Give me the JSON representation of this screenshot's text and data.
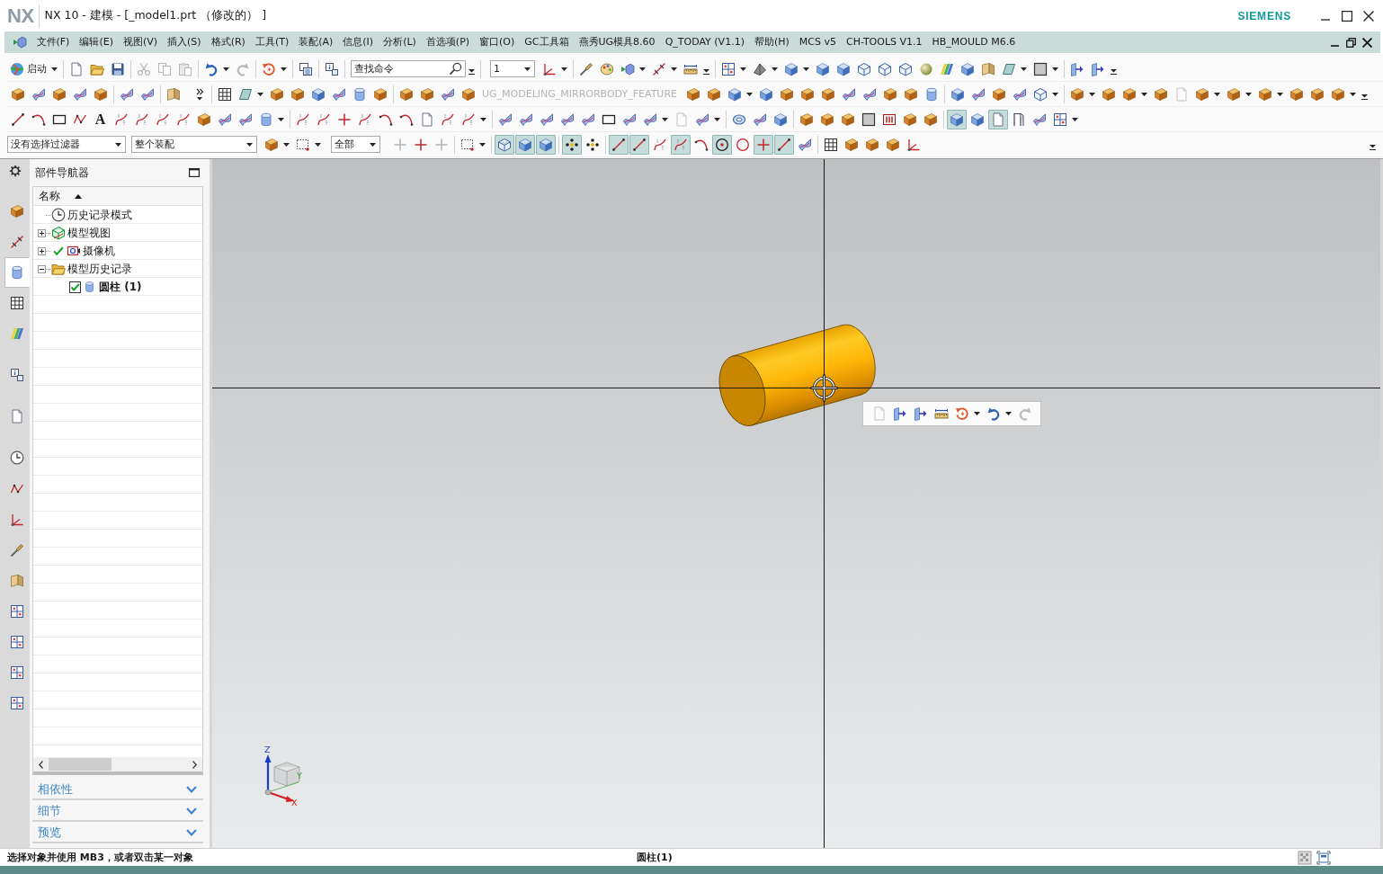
{
  "window": {
    "logo": "NX",
    "title": "NX 10 - 建模 - [_model1.prt （修改的） ]",
    "brand": "SIEMENS"
  },
  "menu_bar": {
    "items": [
      {
        "label": "文件(F)"
      },
      {
        "label": "编辑(E)"
      },
      {
        "label": "视图(V)"
      },
      {
        "label": "插入(S)"
      },
      {
        "label": "格式(R)"
      },
      {
        "label": "工具(T)"
      },
      {
        "label": "装配(A)"
      },
      {
        "label": "信息(I)"
      },
      {
        "label": "分析(L)"
      },
      {
        "label": "首选项(P)"
      },
      {
        "label": "窗口(O)"
      },
      {
        "label": "GC工具箱"
      },
      {
        "label": "燕秀UG模具8.60"
      },
      {
        "label": "Q_TODAY (V1.1)"
      },
      {
        "label": "帮助(H)"
      },
      {
        "label": "MCS v5"
      },
      {
        "label": "CH-TOOLS V1.1"
      },
      {
        "label": "HB_MOULD M6.6"
      }
    ]
  },
  "toolbars": [
    {
      "items": [
        {
          "kind": "start",
          "label": "启动"
        },
        {
          "kind": "separator"
        },
        {
          "kind": "tool",
          "pressed": false,
          "disabled": false
        },
        {
          "kind": "tool",
          "pressed": false,
          "disabled": false
        },
        {
          "kind": "tool",
          "pressed": false,
          "disabled": false
        },
        {
          "kind": "separator"
        },
        {
          "kind": "tool",
          "pressed": false,
          "disabled": true
        },
        {
          "kind": "tool",
          "pressed": false,
          "disabled": true
        },
        {
          "kind": "tool",
          "pressed": false,
          "disabled": true
        },
        {
          "kind": "separator"
        },
        {
          "kind": "split",
          "pressed": false,
          "disabled": false
        },
        {
          "kind": "tool",
          "pressed": false,
          "disabled": true
        },
        {
          "kind": "separator"
        },
        {
          "kind": "split",
          "pressed": false,
          "disabled": false
        },
        {
          "kind": "separator"
        },
        {
          "kind": "tool",
          "pressed": false,
          "disabled": false
        },
        {
          "kind": "separator"
        },
        {
          "kind": "tool",
          "pressed": false,
          "disabled": false
        },
        {
          "kind": "separator"
        },
        {
          "kind": "search",
          "placeholder": "查找命令"
        },
        {
          "kind": "overflow"
        },
        {
          "kind": "separator"
        },
        {
          "kind": "select",
          "value": "1"
        },
        {
          "kind": "split",
          "pressed": false,
          "disabled": false
        },
        {
          "kind": "separator"
        },
        {
          "kind": "tool",
          "pressed": false,
          "disabled": false
        },
        {
          "kind": "tool",
          "pressed": false,
          "disabled": false
        },
        {
          "kind": "split",
          "pressed": false,
          "disabled": false
        },
        {
          "kind": "split",
          "pressed": false,
          "disabled": false
        },
        {
          "kind": "tool",
          "pressed": false,
          "disabled": false
        },
        {
          "kind": "overflow"
        },
        {
          "kind": "separator"
        },
        {
          "kind": "split",
          "pressed": false,
          "disabled": false
        },
        {
          "kind": "split",
          "pressed": false,
          "disabled": false
        },
        {
          "kind": "split",
          "pressed": false,
          "disabled": false
        },
        {
          "kind": "tool",
          "pressed": false,
          "disabled": false
        },
        {
          "kind": "tool",
          "pressed": false,
          "disabled": false
        },
        {
          "kind": "tool",
          "pressed": false,
          "disabled": false
        },
        {
          "kind": "tool",
          "pressed": false,
          "disabled": false
        },
        {
          "kind": "tool",
          "pressed": false,
          "disabled": false
        },
        {
          "kind": "tool",
          "pressed": false,
          "disabled": false
        },
        {
          "kind": "tool",
          "pressed": false,
          "disabled": false
        },
        {
          "kind": "tool",
          "pressed": false,
          "disabled": false
        },
        {
          "kind": "tool",
          "pressed": false,
          "disabled": false
        },
        {
          "kind": "split",
          "pressed": false,
          "disabled": false
        },
        {
          "kind": "split",
          "pressed": false,
          "disabled": false
        },
        {
          "kind": "separator"
        },
        {
          "kind": "tool",
          "pressed": false,
          "disabled": false
        },
        {
          "kind": "tool",
          "pressed": false,
          "disabled": false
        },
        {
          "kind": "overflow"
        }
      ]
    },
    {
      "items": [
        {
          "kind": "tool",
          "pressed": false,
          "disabled": false
        },
        {
          "kind": "tool",
          "pressed": false,
          "disabled": false
        },
        {
          "kind": "tool",
          "pressed": false,
          "disabled": false
        },
        {
          "kind": "tool",
          "pressed": false,
          "disabled": false
        },
        {
          "kind": "tool",
          "pressed": false,
          "disabled": false
        },
        {
          "kind": "separator"
        },
        {
          "kind": "tool",
          "pressed": false,
          "disabled": false
        },
        {
          "kind": "tool",
          "pressed": false,
          "disabled": false
        },
        {
          "kind": "separator"
        },
        {
          "kind": "tool",
          "pressed": false,
          "disabled": false
        },
        {
          "kind": "more"
        },
        {
          "kind": "separator"
        },
        {
          "kind": "tool",
          "pressed": false,
          "disabled": false
        },
        {
          "kind": "split",
          "pressed": false,
          "disabled": false
        },
        {
          "kind": "tool",
          "pressed": false,
          "disabled": false
        },
        {
          "kind": "tool",
          "pressed": false,
          "disabled": false
        },
        {
          "kind": "tool",
          "pressed": false,
          "disabled": false
        },
        {
          "kind": "tool",
          "pressed": false,
          "disabled": false
        },
        {
          "kind": "tool",
          "pressed": false,
          "disabled": false
        },
        {
          "kind": "tool",
          "pressed": false,
          "disabled": false
        },
        {
          "kind": "separator"
        },
        {
          "kind": "tool",
          "pressed": false,
          "disabled": false
        },
        {
          "kind": "tool",
          "pressed": false,
          "disabled": false
        },
        {
          "kind": "tool",
          "pressed": false,
          "disabled": false
        },
        {
          "kind": "tool",
          "pressed": false,
          "disabled": false
        },
        {
          "kind": "label",
          "label": "UG_MODELING_MIRRORBODY_FEATURE",
          "disabled": true
        },
        {
          "kind": "tool",
          "pressed": false,
          "disabled": false
        },
        {
          "kind": "tool",
          "pressed": false,
          "disabled": false
        },
        {
          "kind": "split",
          "pressed": false,
          "disabled": false
        },
        {
          "kind": "tool",
          "pressed": false,
          "disabled": false
        },
        {
          "kind": "tool",
          "pressed": false,
          "disabled": false
        },
        {
          "kind": "tool",
          "pressed": false,
          "disabled": false
        },
        {
          "kind": "tool",
          "pressed": false,
          "disabled": false
        },
        {
          "kind": "tool",
          "pressed": false,
          "disabled": false
        },
        {
          "kind": "tool",
          "pressed": false,
          "disabled": false
        },
        {
          "kind": "tool",
          "pressed": false,
          "disabled": false
        },
        {
          "kind": "tool",
          "pressed": false,
          "disabled": false
        },
        {
          "kind": "tool",
          "pressed": false,
          "disabled": false
        },
        {
          "kind": "separator"
        },
        {
          "kind": "tool",
          "pressed": false,
          "disabled": false
        },
        {
          "kind": "tool",
          "pressed": false,
          "disabled": false
        },
        {
          "kind": "tool",
          "pressed": false,
          "disabled": false
        },
        {
          "kind": "tool",
          "pressed": false,
          "disabled": false
        },
        {
          "kind": "split",
          "pressed": false,
          "disabled": false
        },
        {
          "kind": "separator"
        },
        {
          "kind": "split",
          "pressed": false,
          "disabled": false
        },
        {
          "kind": "tool",
          "pressed": false,
          "disabled": false
        },
        {
          "kind": "split",
          "pressed": false,
          "disabled": false
        },
        {
          "kind": "tool",
          "pressed": false,
          "disabled": false
        },
        {
          "kind": "tool",
          "pressed": false,
          "disabled": true
        },
        {
          "kind": "split",
          "pressed": false,
          "disabled": false
        },
        {
          "kind": "split",
          "pressed": false,
          "disabled": false
        },
        {
          "kind": "split",
          "pressed": false,
          "disabled": false
        },
        {
          "kind": "tool",
          "pressed": false,
          "disabled": false
        },
        {
          "kind": "tool",
          "pressed": false,
          "disabled": false
        },
        {
          "kind": "split",
          "pressed": false,
          "disabled": false
        },
        {
          "kind": "overflow"
        }
      ]
    },
    {
      "items": [
        {
          "kind": "tool",
          "pressed": false,
          "disabled": false
        },
        {
          "kind": "tool",
          "pressed": false,
          "disabled": false
        },
        {
          "kind": "tool",
          "pressed": false,
          "disabled": false
        },
        {
          "kind": "tool",
          "pressed": false,
          "disabled": false
        },
        {
          "kind": "glyph",
          "label": "A"
        },
        {
          "kind": "tool",
          "pressed": false,
          "disabled": false
        },
        {
          "kind": "tool",
          "pressed": false,
          "disabled": false
        },
        {
          "kind": "tool",
          "pressed": false,
          "disabled": false
        },
        {
          "kind": "tool",
          "pressed": false,
          "disabled": false
        },
        {
          "kind": "tool",
          "pressed": false,
          "disabled": false
        },
        {
          "kind": "tool",
          "pressed": false,
          "disabled": false
        },
        {
          "kind": "tool",
          "pressed": false,
          "disabled": false
        },
        {
          "kind": "split",
          "pressed": false,
          "disabled": false
        },
        {
          "kind": "separator"
        },
        {
          "kind": "tool",
          "pressed": false,
          "disabled": false
        },
        {
          "kind": "tool",
          "pressed": false,
          "disabled": false
        },
        {
          "kind": "tool",
          "pressed": false,
          "disabled": false
        },
        {
          "kind": "tool",
          "pressed": false,
          "disabled": false
        },
        {
          "kind": "tool",
          "pressed": false,
          "disabled": false
        },
        {
          "kind": "tool",
          "pressed": false,
          "disabled": false
        },
        {
          "kind": "tool",
          "pressed": false,
          "disabled": false
        },
        {
          "kind": "tool",
          "pressed": false,
          "disabled": false
        },
        {
          "kind": "split",
          "pressed": false,
          "disabled": false
        },
        {
          "kind": "separator"
        },
        {
          "kind": "tool",
          "pressed": false,
          "disabled": false
        },
        {
          "kind": "tool",
          "pressed": false,
          "disabled": false
        },
        {
          "kind": "tool",
          "pressed": false,
          "disabled": false
        },
        {
          "kind": "tool",
          "pressed": false,
          "disabled": false
        },
        {
          "kind": "tool",
          "pressed": false,
          "disabled": false
        },
        {
          "kind": "tool",
          "pressed": false,
          "disabled": false
        },
        {
          "kind": "tool",
          "pressed": false,
          "disabled": false
        },
        {
          "kind": "split",
          "pressed": false,
          "disabled": false
        },
        {
          "kind": "tool",
          "pressed": false,
          "disabled": true
        },
        {
          "kind": "split",
          "pressed": false,
          "disabled": false
        },
        {
          "kind": "separator"
        },
        {
          "kind": "tool",
          "pressed": false,
          "disabled": false
        },
        {
          "kind": "tool",
          "pressed": false,
          "disabled": false
        },
        {
          "kind": "tool",
          "pressed": false,
          "disabled": false
        },
        {
          "kind": "separator"
        },
        {
          "kind": "tool",
          "pressed": false,
          "disabled": false
        },
        {
          "kind": "tool",
          "pressed": false,
          "disabled": false
        },
        {
          "kind": "tool",
          "pressed": false,
          "disabled": false
        },
        {
          "kind": "tool",
          "pressed": false,
          "disabled": false
        },
        {
          "kind": "tool",
          "pressed": false,
          "disabled": false
        },
        {
          "kind": "tool",
          "pressed": false,
          "disabled": false
        },
        {
          "kind": "tool",
          "pressed": false,
          "disabled": false
        },
        {
          "kind": "separator"
        },
        {
          "kind": "tool",
          "pressed": true,
          "disabled": false
        },
        {
          "kind": "tool",
          "pressed": false,
          "disabled": false
        },
        {
          "kind": "tool",
          "pressed": true,
          "disabled": false
        },
        {
          "kind": "tool",
          "pressed": false,
          "disabled": false
        },
        {
          "kind": "tool",
          "pressed": false,
          "disabled": false
        },
        {
          "kind": "split",
          "pressed": false,
          "disabled": false
        }
      ]
    },
    {
      "items": [
        {
          "kind": "select",
          "value": "没有选择过滤器"
        },
        {
          "kind": "select",
          "value": "整个装配"
        },
        {
          "kind": "split",
          "pressed": false,
          "disabled": false
        },
        {
          "kind": "split",
          "pressed": false,
          "disabled": false
        },
        {
          "kind": "select",
          "value": "全部"
        },
        {
          "kind": "tool",
          "pressed": false,
          "disabled": true
        },
        {
          "kind": "tool",
          "pressed": false,
          "disabled": false
        },
        {
          "kind": "tool",
          "pressed": false,
          "disabled": true
        },
        {
          "kind": "separator"
        },
        {
          "kind": "split",
          "pressed": false,
          "disabled": false
        },
        {
          "kind": "separator"
        },
        {
          "kind": "tool",
          "pressed": true,
          "disabled": false
        },
        {
          "kind": "tool",
          "pressed": true,
          "disabled": false
        },
        {
          "kind": "tool",
          "pressed": true,
          "disabled": false
        },
        {
          "kind": "separator"
        },
        {
          "kind": "tool",
          "pressed": true,
          "disabled": false
        },
        {
          "kind": "tool",
          "pressed": false,
          "disabled": false
        },
        {
          "kind": "separator"
        },
        {
          "kind": "tool",
          "pressed": true,
          "disabled": false
        },
        {
          "kind": "tool",
          "pressed": true,
          "disabled": false
        },
        {
          "kind": "tool",
          "pressed": false,
          "disabled": false
        },
        {
          "kind": "tool",
          "pressed": true,
          "disabled": false
        },
        {
          "kind": "tool",
          "pressed": false,
          "disabled": false
        },
        {
          "kind": "tool",
          "pressed": true,
          "disabled": false
        },
        {
          "kind": "tool",
          "pressed": false,
          "disabled": false
        },
        {
          "kind": "tool",
          "pressed": true,
          "disabled": false
        },
        {
          "kind": "tool",
          "pressed": true,
          "disabled": false
        },
        {
          "kind": "tool",
          "pressed": false,
          "disabled": false
        },
        {
          "kind": "separator"
        },
        {
          "kind": "tool",
          "pressed": false,
          "disabled": false
        },
        {
          "kind": "tool",
          "pressed": false,
          "disabled": false
        },
        {
          "kind": "tool",
          "pressed": false,
          "disabled": false
        },
        {
          "kind": "tool",
          "pressed": false,
          "disabled": false
        },
        {
          "kind": "tool",
          "pressed": false,
          "disabled": false
        },
        {
          "kind": "overflow"
        }
      ]
    }
  ],
  "resource_bar": {
    "tabs": [
      {
        "selected": false
      },
      {
        "selected": false
      },
      {
        "selected": true
      },
      {
        "selected": false
      },
      {
        "selected": false
      },
      {
        "selected": false
      },
      {
        "selected": false
      },
      {
        "selected": false
      },
      {
        "selected": false
      },
      {
        "selected": false
      },
      {
        "selected": false
      },
      {
        "selected": false
      },
      {
        "selected": false
      },
      {
        "selected": false
      },
      {
        "selected": false
      },
      {
        "selected": false
      }
    ]
  },
  "part_navigator": {
    "title": "部件导航器",
    "column": {
      "label": "名称",
      "sort_ascending": true
    },
    "tree": [
      {
        "label": "历史记录模式",
        "kind": "mode"
      },
      {
        "label": "模型视图",
        "kind": "group",
        "expanded": false,
        "active": false
      },
      {
        "label": "摄像机",
        "kind": "group",
        "expanded": false,
        "active": true
      },
      {
        "label": "模型历史记录",
        "kind": "group",
        "expanded": true,
        "active": false,
        "children": [
          {
            "label": "圆柱 (1)",
            "kind": "feature",
            "checked": true
          }
        ]
      }
    ],
    "panels": [
      {
        "label": "相依性",
        "expanded": false
      },
      {
        "label": "细节",
        "expanded": false
      },
      {
        "label": "预览",
        "expanded": false
      }
    ]
  },
  "viewport": {
    "popup_toolbar": {
      "items": [
        {
          "kind": "tool",
          "pressed": false,
          "disabled": true
        },
        {
          "kind": "tool",
          "pressed": false,
          "disabled": false
        },
        {
          "kind": "tool",
          "pressed": false,
          "disabled": false
        },
        {
          "kind": "tool",
          "pressed": false,
          "disabled": false
        },
        {
          "kind": "split",
          "pressed": false,
          "disabled": false
        },
        {
          "kind": "split",
          "pressed": false,
          "disabled": false
        },
        {
          "kind": "tool",
          "pressed": false,
          "disabled": true
        }
      ]
    },
    "triad": {
      "x_label": "X",
      "y_label": "Y",
      "z_label": "Z"
    }
  },
  "status_bar": {
    "prompt": "选择对象并使用 MB3，或者双击某一对象",
    "selection": "圆柱(1)"
  }
}
